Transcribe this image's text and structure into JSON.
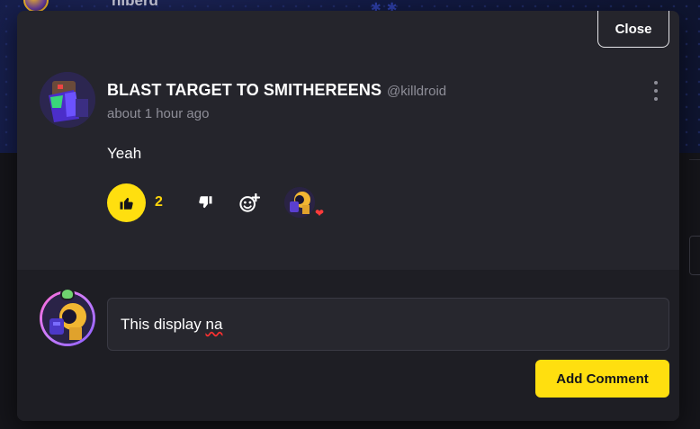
{
  "background": {
    "username": "hiberd"
  },
  "modal": {
    "close_label": "Close"
  },
  "comment": {
    "author_name": "BLAST TARGET TO SMITHEREENS",
    "author_handle": "@killdroid",
    "timestamp": "about 1 hour ago",
    "text": "Yeah",
    "like_count": "2",
    "reactions": [
      {
        "emoji": "heart",
        "color": "#ff3b3b"
      }
    ]
  },
  "reply": {
    "input_value_prefix": "This display ",
    "input_value_misspelled": "na",
    "add_button_label": "Add Comment"
  },
  "colors": {
    "accent": "#ffdf0f",
    "modal_bg": "#25252c",
    "reply_bg": "#1e1e24",
    "muted_text": "#8e8e98"
  }
}
